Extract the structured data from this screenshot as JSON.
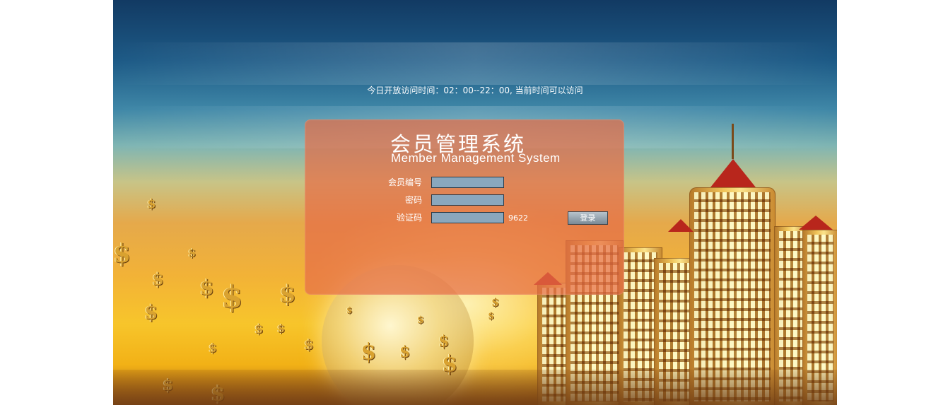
{
  "notice": {
    "text": "今日开放访问时间：02：00--22：00, 当前时间可以访问"
  },
  "login": {
    "title_cn": "会员管理系统",
    "title_en": "Member Management System",
    "member_id_label": "会员编号",
    "member_id_value": "",
    "password_label": "密码",
    "password_value": "",
    "captcha_label": "验证码",
    "captcha_value": "",
    "captcha_code": "9622",
    "login_button": "登录"
  },
  "decor": {
    "dollar_symbol": "$"
  },
  "colors": {
    "panel": "#e66e46",
    "input_bg": "#8aa7bd",
    "button": "#9aa8b2"
  }
}
